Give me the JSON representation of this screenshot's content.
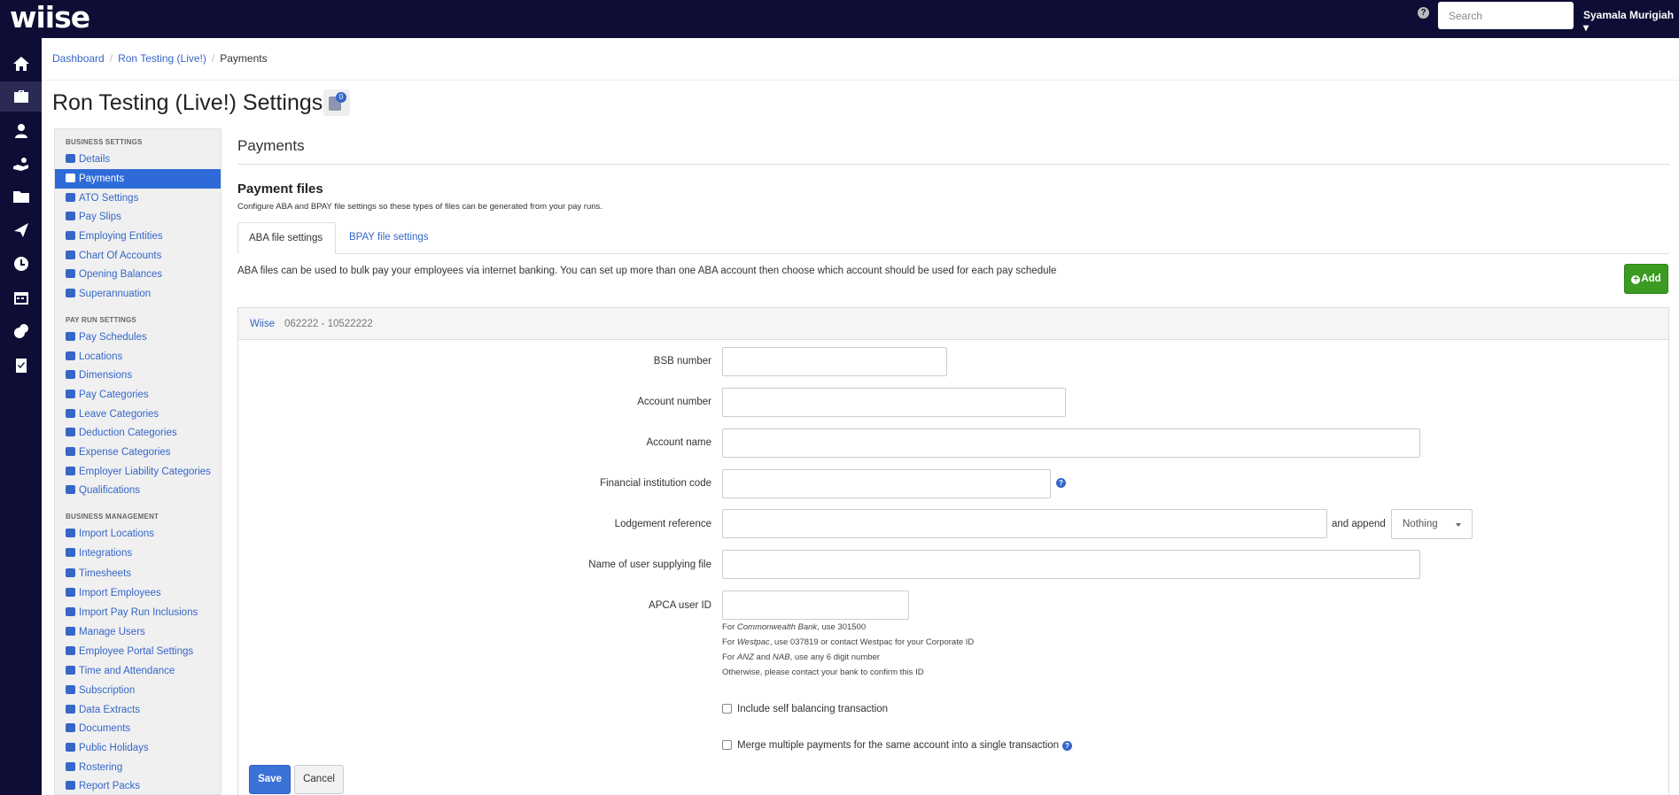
{
  "app": {
    "logo": "wiise",
    "search_placeholder": "Search",
    "user_name": "Syamala Murigiah"
  },
  "left_nav": [
    "home-icon",
    "briefcase-icon",
    "people-icon",
    "hand-coin-icon",
    "folder-icon",
    "plane-icon",
    "clock-icon",
    "calendar-icon",
    "coins-icon",
    "clipboard-check-icon"
  ],
  "breadcrumb": {
    "dashboard": "Dashboard",
    "business": "Ron Testing (Live!)",
    "current": "Payments"
  },
  "page": {
    "title": "Ron Testing (Live!) Settings",
    "notes_count": "0"
  },
  "sidebar": {
    "business_settings_header": "BUSINESS SETTINGS",
    "business_settings": [
      "Details",
      "Payments",
      "ATO Settings",
      "Pay Slips",
      "Employing Entities",
      "Chart Of Accounts",
      "Opening Balances",
      "Superannuation"
    ],
    "pay_run_header": "PAY RUN SETTINGS",
    "pay_run": [
      "Pay Schedules",
      "Locations",
      "Dimensions",
      "Pay Categories",
      "Leave Categories",
      "Deduction Categories",
      "Expense Categories",
      "Employer Liability Categories",
      "Qualifications"
    ],
    "business_mgmt_header": "BUSINESS MANAGEMENT",
    "business_mgmt": [
      "Import Locations",
      "Integrations",
      "Timesheets",
      "Import Employees",
      "Import Pay Run Inclusions",
      "Manage Users",
      "Employee Portal Settings",
      "Time and Attendance",
      "Subscription",
      "Data Extracts",
      "Documents",
      "Public Holidays",
      "Rostering",
      "Report Packs"
    ]
  },
  "main": {
    "title": "Payments",
    "section_title": "Payment files",
    "section_desc": "Configure ABA and BPAY file settings so these types of files can be generated from your pay runs.",
    "tabs": [
      "ABA file settings",
      "BPAY file settings"
    ],
    "aba_desc": "ABA files can be used to bulk pay your employees via internet banking. You can set up more than one ABA account then choose which account should be used for each pay schedule",
    "add_label": "Add",
    "account": {
      "name": "Wiise",
      "number": "062222 - 10522222"
    },
    "form": {
      "bsb_label": "BSB number",
      "account_number_label": "Account number",
      "account_name_label": "Account name",
      "fi_code_label": "Financial institution code",
      "lodgement_label": "Lodgement reference",
      "append_label": "and append",
      "append_value": "Nothing",
      "user_supplying_label": "Name of user supplying file",
      "apca_label": "APCA user ID",
      "hint_cba_prefix": "For ",
      "hint_cba_bank": "Commonwealth Bank",
      "hint_cba_suffix": ", use 301500",
      "hint_westpac_prefix": "For ",
      "hint_westpac_bank": "Westpac",
      "hint_westpac_suffix": ", use 037819 or contact Westpac for your Corporate ID",
      "hint_anz_prefix": "For ",
      "hint_anz_bank": "ANZ",
      "hint_anz_and": " and ",
      "hint_nab_bank": "NAB",
      "hint_anz_suffix": ", use any 6 digit number",
      "hint_other": "Otherwise, please contact your bank to confirm this ID",
      "self_balancing_label": "Include self balancing transaction",
      "merge_label": "Merge multiple payments for the same account into a single transaction"
    },
    "save_label": "Save",
    "cancel_label": "Cancel"
  }
}
